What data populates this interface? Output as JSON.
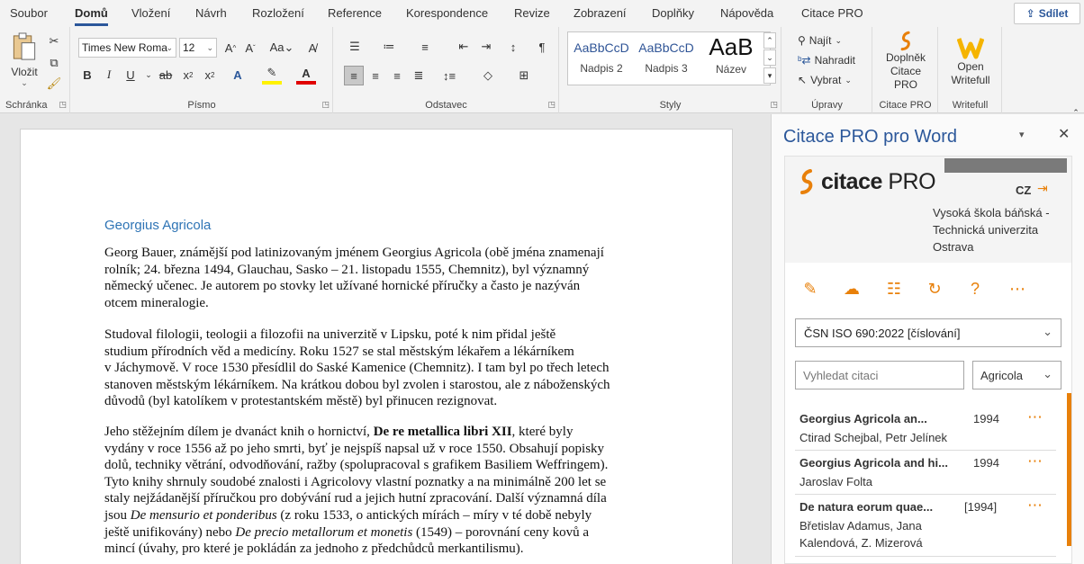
{
  "tabs": [
    "Soubor",
    "Domů",
    "Vložení",
    "Návrh",
    "Rozložení",
    "Reference",
    "Korespondence",
    "Revize",
    "Zobrazení",
    "Doplňky",
    "Nápověda",
    "Citace PRO"
  ],
  "share_label": "Sdílet",
  "ribbon": {
    "clipboard": {
      "paste_label": "Vložit",
      "group": "Schránka"
    },
    "font": {
      "font_name": "Times New Roma",
      "font_size": "12",
      "group": "Písmo"
    },
    "paragraph": {
      "group": "Odstavec"
    },
    "styles": {
      "items": [
        {
          "preview": "AaBbCcD",
          "name": "Nadpis 2"
        },
        {
          "preview": "AaBbCcD",
          "name": "Nadpis 3"
        },
        {
          "preview": "AaB",
          "name": "Název"
        }
      ],
      "group": "Styly"
    },
    "editing": {
      "find": "Najít",
      "replace": "Nahradit",
      "select": "Vybrat",
      "group": "Úpravy"
    },
    "citace": {
      "button": "Doplněk Citace PRO",
      "group": "Citace PRO"
    },
    "writefull": {
      "button": "Open Writefull",
      "group": "Writefull"
    }
  },
  "document": {
    "heading": "Georgius Agricola",
    "p1": [
      "Georg Bauer, známější pod latinizovaným jménem Georgius Agricola (obě jména znamenají",
      "rolník; 24. března 1494, Glauchau, Sasko – 21. listopadu 1555, Chemnitz), byl významný",
      "německý učenec. Je autorem po stovky let užívané hornické příručky a často je nazýván",
      "otcem mineralogie."
    ],
    "p2": [
      "Studoval filologii, teologii a filozofii na univerzitě v Lipsku, poté k nim přidal ještě",
      "studium přírodních věd a medicíny. Roku 1527 se stal městským lékařem a lékárníkem",
      "v Jáchymově. V roce 1530 přesídlil do Saské Kamenice (Chemnitz). I tam byl po třech letech",
      "stanoven městským lékárníkem. Na krátkou dobou byl zvolen i starostou, ale z náboženských",
      "důvodů (byl katolíkem v protestantském městě) byl přinucen rezignovat."
    ],
    "p3_line1_start": "Jeho stěžejním dílem je dvanáct knih o hornictví, ",
    "p3_line1_bold": "De re metallica libri XII",
    "p3_line1_end": ", které byly",
    "p3_lines": [
      "vydány v roce 1556 až po jeho smrti, byť je nejspíš napsal už v roce 1550. Obsahují popisky",
      "dolů, techniky větrání, odvodňování, ražby (spolupracoval s grafikem Basiliem Weffringem).",
      "Tyto knihy shrnuly soudobé znalosti i Agricolovy vlastní poznatky a na minimálně 200 let se",
      "staly nejžádanější příručkou pro dobývání rud a jejich hutní zpracování. Další významná díla"
    ],
    "p3_l6_a": "jsou ",
    "p3_l6_i": "De mensurio et ponderibus",
    "p3_l6_b": " (z roku 1533, o antických mírách – míry v té době nebyly",
    "p3_l7_a": "ještě unifikovány) nebo ",
    "p3_l7_i": "De precio metallorum et monetis",
    "p3_l7_b": " (1549) – porovnání ceny kovů a",
    "p3_l8": "mincí (úvahy, pro které je pokládán za jednoho z předchůdců merkantilismu)."
  },
  "pane": {
    "title": "Citace PRO pro Word",
    "logo_a": "citace ",
    "logo_b": "PRO",
    "lang": "CZ",
    "institution": [
      "Vysoká škola báňská -",
      "Technická univerzita",
      "Ostrava"
    ],
    "style_select": "ČSN ISO 690:2022 [číslování]",
    "search_placeholder": "Vyhledat citaci",
    "filter": "Agricola",
    "citations": [
      {
        "title": "Georgius Agricola an...",
        "year": "1994",
        "authors": "Ctirad Schejbal, Petr Jelínek"
      },
      {
        "title": "Georgius Agricola and hi...",
        "year": "1994",
        "authors": "Jaroslav Folta"
      },
      {
        "title": "De natura eorum quae...",
        "year": "[1994]",
        "authors": "Břetislav Adamus, Jana Kalendová, Z. Mizerová"
      }
    ]
  }
}
